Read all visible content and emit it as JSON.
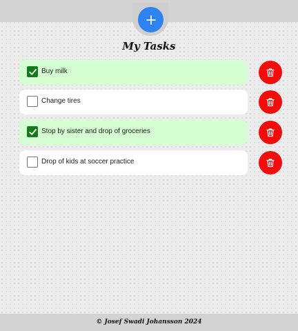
{
  "add_button": {
    "icon": "plus-icon",
    "color": "#2f83f1"
  },
  "title": "My Tasks",
  "tasks": [
    {
      "label": "Buy milk",
      "checked": true
    },
    {
      "label": "Change tires",
      "checked": false
    },
    {
      "label": "Stop by sister and drop of groceries",
      "checked": true
    },
    {
      "label": "Drop of kids at soccer practice",
      "checked": false
    }
  ],
  "delete_button": {
    "icon": "trash-icon",
    "color": "#f30c0c"
  },
  "colors": {
    "completed_row": "#d5fdd2",
    "open_row": "#ffffff",
    "checkbox_checked": "#157a1b"
  },
  "footer": {
    "text": "© Josef Swadi Johansson 2024"
  }
}
